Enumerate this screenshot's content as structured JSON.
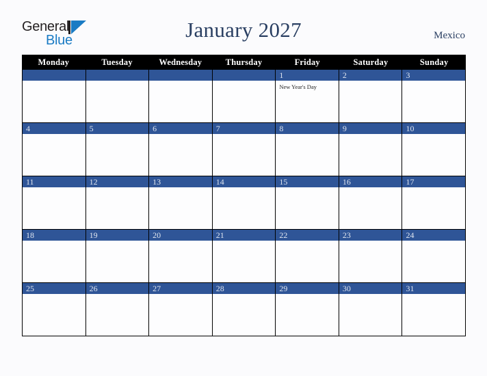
{
  "brand": {
    "name_part1": "General",
    "name_part2": "Blue",
    "mark": "blue-triangle-icon"
  },
  "header": {
    "title": "January 2027",
    "region": "Mexico"
  },
  "colors": {
    "date_bar_blue": "#2f5597",
    "weekday_header_bg": "#000000",
    "title_navy": "#2a3f62",
    "logo_blue": "#1a7bc4",
    "page_background": "#fbfbfd"
  },
  "calendar": {
    "month": "January",
    "year": "2027",
    "weekday_headers": [
      "Monday",
      "Tuesday",
      "Wednesday",
      "Thursday",
      "Friday",
      "Saturday",
      "Sunday"
    ],
    "weeks": [
      [
        {
          "number": "",
          "event": ""
        },
        {
          "number": "",
          "event": ""
        },
        {
          "number": "",
          "event": ""
        },
        {
          "number": "",
          "event": ""
        },
        {
          "number": "1",
          "event": "New Year's Day"
        },
        {
          "number": "2",
          "event": ""
        },
        {
          "number": "3",
          "event": ""
        }
      ],
      [
        {
          "number": "4",
          "event": ""
        },
        {
          "number": "5",
          "event": ""
        },
        {
          "number": "6",
          "event": ""
        },
        {
          "number": "7",
          "event": ""
        },
        {
          "number": "8",
          "event": ""
        },
        {
          "number": "9",
          "event": ""
        },
        {
          "number": "10",
          "event": ""
        }
      ],
      [
        {
          "number": "11",
          "event": ""
        },
        {
          "number": "12",
          "event": ""
        },
        {
          "number": "13",
          "event": ""
        },
        {
          "number": "14",
          "event": ""
        },
        {
          "number": "15",
          "event": ""
        },
        {
          "number": "16",
          "event": ""
        },
        {
          "number": "17",
          "event": ""
        }
      ],
      [
        {
          "number": "18",
          "event": ""
        },
        {
          "number": "19",
          "event": ""
        },
        {
          "number": "20",
          "event": ""
        },
        {
          "number": "21",
          "event": ""
        },
        {
          "number": "22",
          "event": ""
        },
        {
          "number": "23",
          "event": ""
        },
        {
          "number": "24",
          "event": ""
        }
      ],
      [
        {
          "number": "25",
          "event": ""
        },
        {
          "number": "26",
          "event": ""
        },
        {
          "number": "27",
          "event": ""
        },
        {
          "number": "28",
          "event": ""
        },
        {
          "number": "29",
          "event": ""
        },
        {
          "number": "30",
          "event": ""
        },
        {
          "number": "31",
          "event": ""
        }
      ]
    ]
  }
}
